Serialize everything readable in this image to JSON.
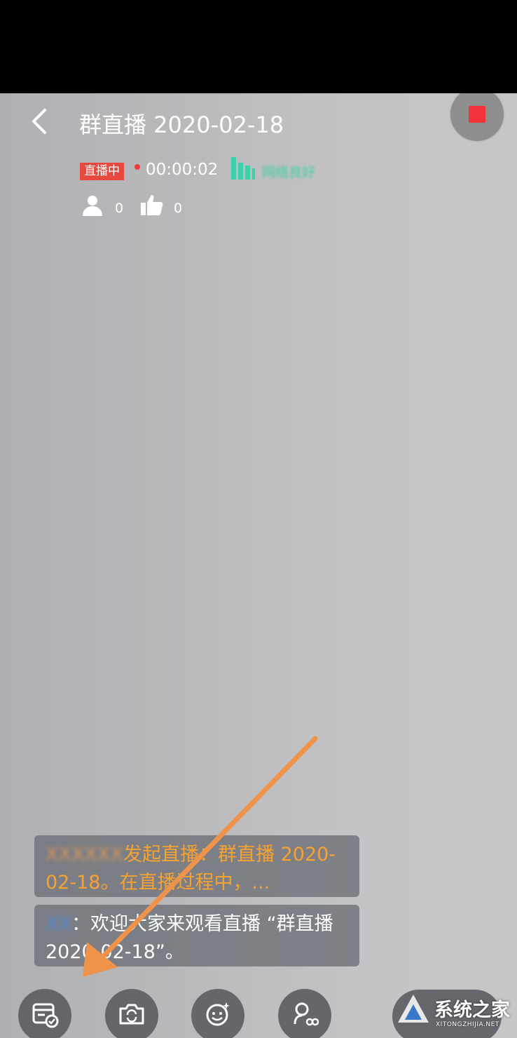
{
  "header": {
    "title": "群直播 2020-02-18",
    "live_badge": "直播中",
    "timer": "00:00:02",
    "network_status": "网络良好",
    "viewer_count": "0",
    "like_count": "0"
  },
  "messages": [
    {
      "sender": "XXXXXX",
      "text": "发起直播：群直播 2020-02-18。在直播过程中，..."
    },
    {
      "sender": "XX",
      "text": "：欢迎大家来观看直播 “群直播 2020-02-18”。"
    }
  ],
  "toolbar": {
    "buttons": [
      "checklist-icon",
      "camera-switch-icon",
      "beauty-face-icon",
      "mic-link-icon"
    ]
  },
  "watermark": {
    "text": "系统之家",
    "sub": "XITONGZHIJIA.NET"
  },
  "colors": {
    "live_badge": "#e8493e",
    "stop": "#f0343a",
    "network": "#3ed0a8",
    "system_message": "#f5a233",
    "annotation_arrow": "#f0934a"
  }
}
